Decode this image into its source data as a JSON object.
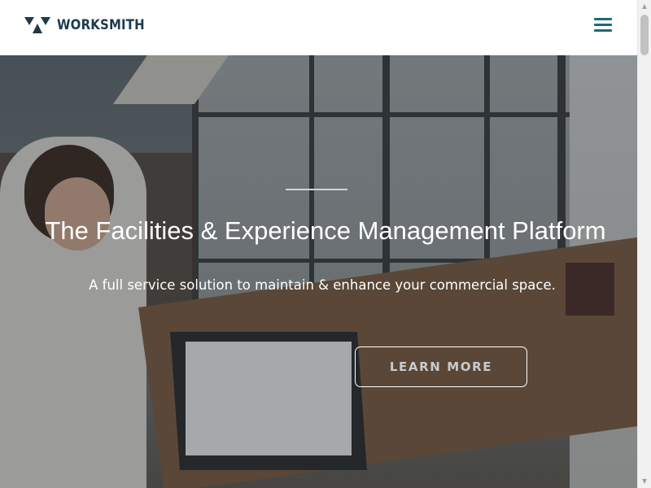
{
  "header": {
    "brand": "WORKSMITH",
    "logo_icon": "worksmith-logo-icon",
    "menu_icon": "hamburger-menu-icon"
  },
  "hero": {
    "headline": "The Facilities & Experience Management Platform",
    "subheadline": "A full service solution to maintain & enhance your commercial space.",
    "cta_label": "LEARN MORE"
  },
  "colors": {
    "brand_dark": "#1e3a4c",
    "menu_accent": "#1d6a74",
    "hero_text": "#ffffff"
  }
}
